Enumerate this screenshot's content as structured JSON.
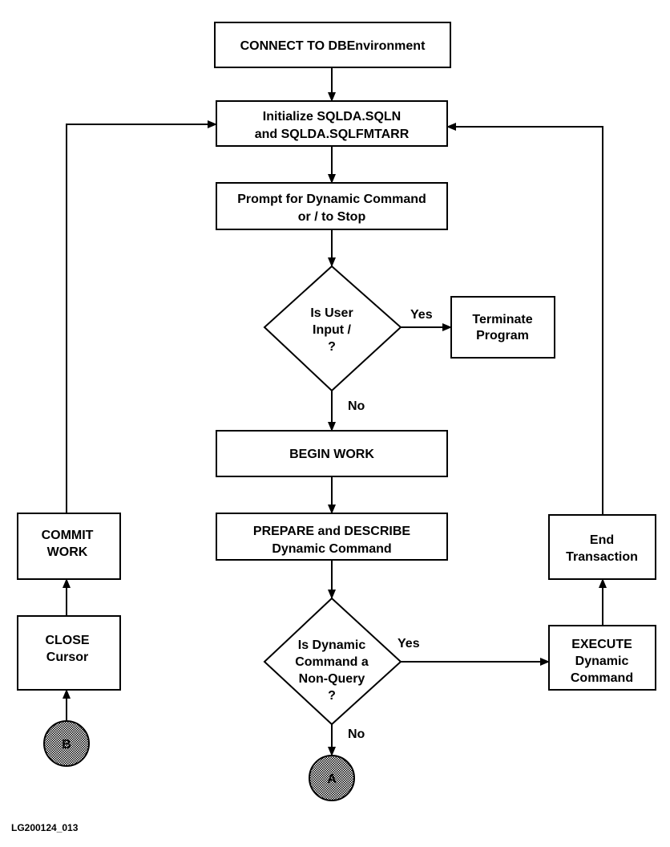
{
  "nodes": {
    "connect": [
      "CONNECT TO DBEnvironment"
    ],
    "initialize": [
      "Initialize SQLDA.SQLN",
      "and SQLDA.SQLFMTARR"
    ],
    "prompt": [
      "Prompt for Dynamic Command",
      "or / to Stop"
    ],
    "decision_stop": [
      "Is User",
      "Input /",
      "?"
    ],
    "terminate": [
      "Terminate",
      "Program"
    ],
    "begin_work": [
      "BEGIN WORK"
    ],
    "prepare": [
      "PREPARE and DESCRIBE",
      "Dynamic Command"
    ],
    "decision_query": [
      "Is Dynamic",
      "Command a",
      "Non-Query",
      "?"
    ],
    "execute": [
      "EXECUTE",
      "Dynamic",
      "Command"
    ],
    "end_transaction": [
      "End",
      "Transaction"
    ],
    "commit": [
      "COMMIT",
      "WORK"
    ],
    "close": [
      "CLOSE",
      "Cursor"
    ],
    "connector_a": "A",
    "connector_b": "B"
  },
  "edge_labels": {
    "stop_yes": "Yes",
    "stop_no": "No",
    "query_yes": "Yes",
    "query_no": "No"
  },
  "figure_id": "LG200124_013",
  "colors": {
    "line": "#000000",
    "connector_fill": "#a0a0a0"
  }
}
